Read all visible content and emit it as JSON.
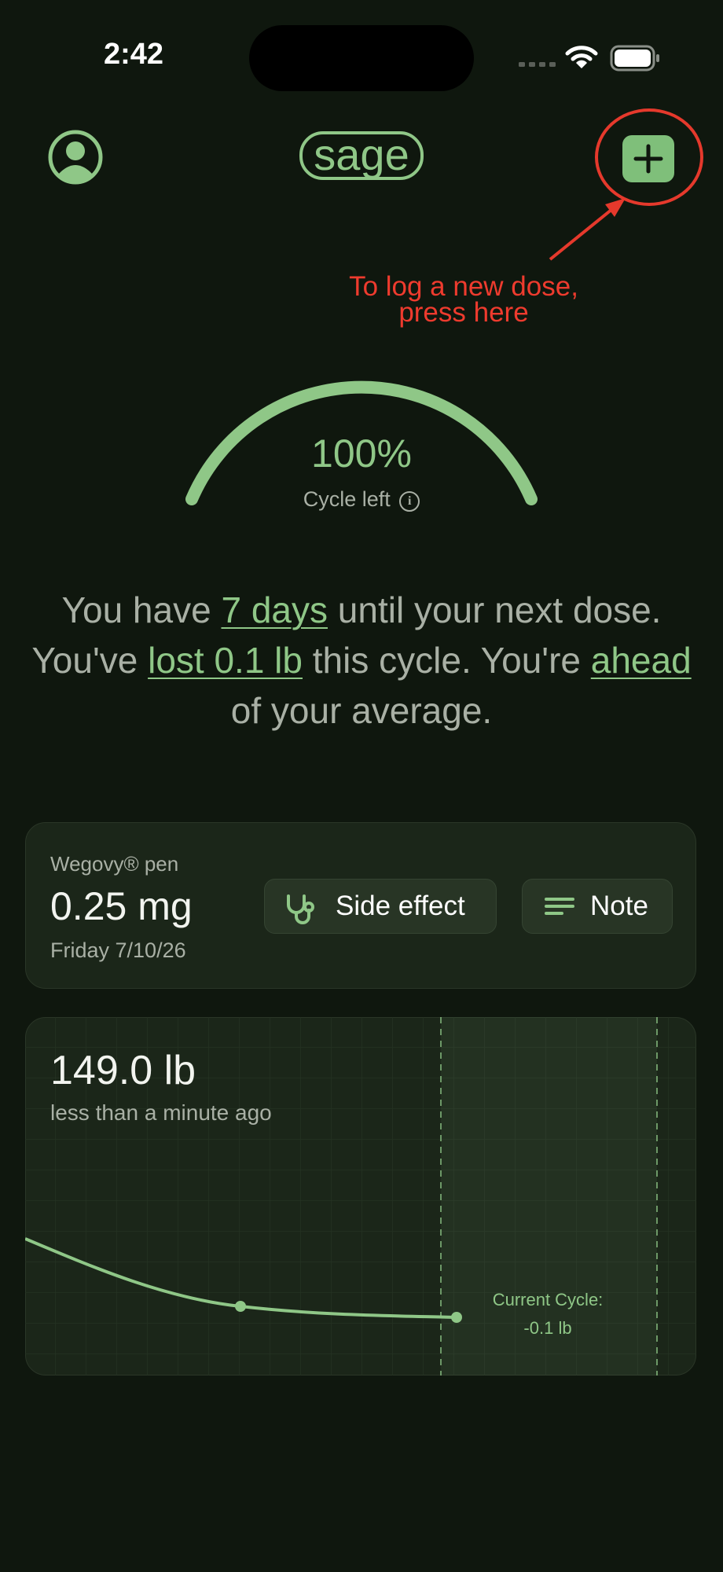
{
  "status": {
    "time": "2:42"
  },
  "header": {
    "logo_text": "sage"
  },
  "annotation": {
    "line1": "To log a new dose,",
    "line2": "press here"
  },
  "gauge": {
    "percent_text": "100%",
    "fraction": 1.0,
    "label": "Cycle left"
  },
  "summary": {
    "p1": "You have ",
    "days": "7 days",
    "p2": " until your next dose. You've ",
    "lost": "lost 0.1 lb",
    "p3": " this cycle. You're ",
    "ahead": "ahead",
    "p4": " of your average."
  },
  "dose_card": {
    "pen_name": "Wegovy® pen",
    "dose": "0.25 mg",
    "date": "Friday 7/10/26",
    "side_effect_label": "Side effect",
    "note_label": "Note"
  },
  "weight_card": {
    "weight": "149.0 lb",
    "time_ago": "less than a minute ago",
    "cycle_label_1": "Current Cycle:",
    "cycle_label_2": "-0.1 lb"
  },
  "colors": {
    "accent": "#8fc787",
    "annotation": "#e5392c",
    "background": "#0f170e",
    "card": "#1b2619"
  }
}
